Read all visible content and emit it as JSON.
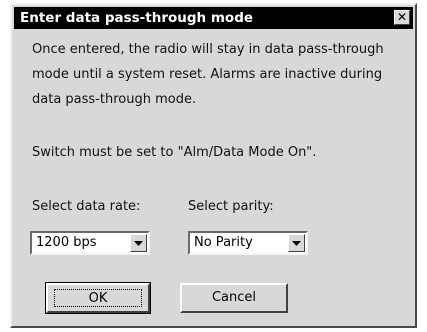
{
  "window": {
    "title": "Enter data pass-through mode",
    "close_glyph": "✕"
  },
  "message": {
    "text": "Once entered, the radio will stay in data pass-through mode until a system reset.  Alarms are inactive during data pass-through mode.",
    "switch_note": "Switch must be set to \"Alm/Data Mode On\"."
  },
  "data_rate": {
    "label": "Select data rate:",
    "value": "1200 bps"
  },
  "parity": {
    "label": "Select parity:",
    "value": "No Parity"
  },
  "buttons": {
    "ok_label": "OK",
    "cancel_label": "Cancel"
  },
  "icons": {
    "close": "close-icon",
    "dropdown": "dropdown-arrow-icon"
  },
  "colors": {
    "titlebar": "#000000",
    "dialog_face": "#d8d8d8"
  }
}
